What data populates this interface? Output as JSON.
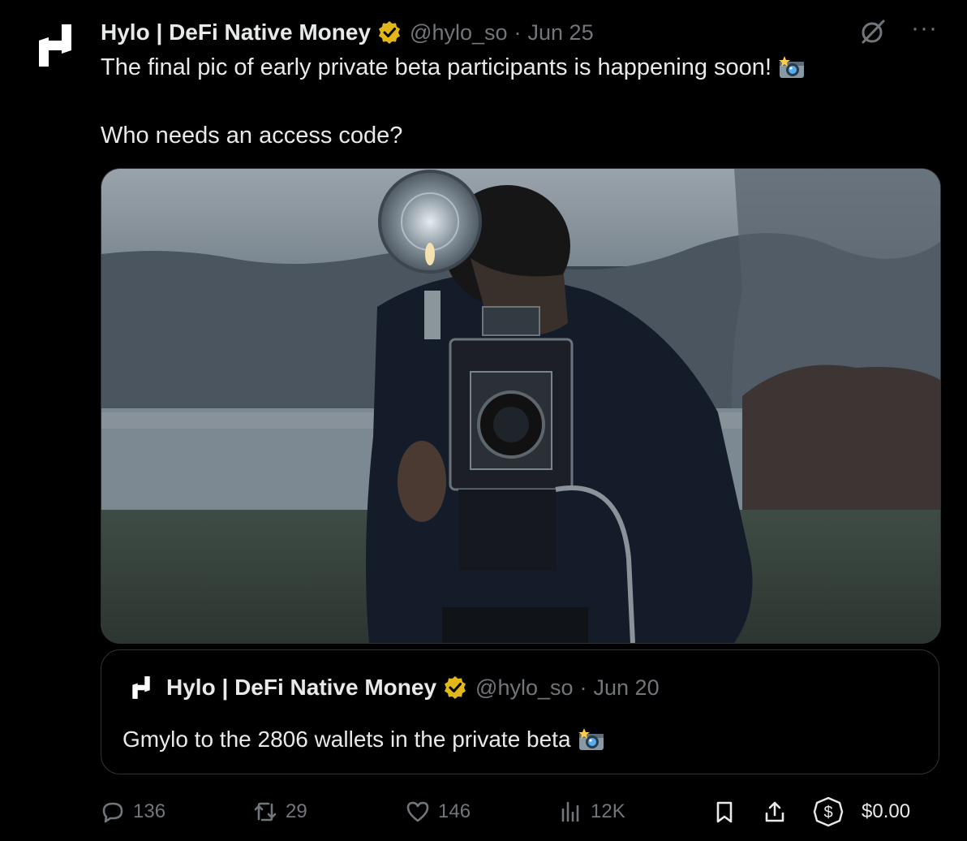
{
  "tweet": {
    "author_name": "Hylo | DeFi Native Money",
    "handle": "@hylo_so",
    "separator": "·",
    "date": "Jun 25",
    "text_line1": "The final pic of early private beta participants is happening soon!",
    "text_line2": "Who needs an access code?",
    "media_description": "Man looking through vintage press camera with flash outdoors",
    "icons": {
      "avatar": "hylo-logo-icon",
      "verified": "verified-badge-icon",
      "grok": "grok-icon",
      "more": "more-icon",
      "emoji": "camera-flash-emoji"
    },
    "more_glyph": "···"
  },
  "quote": {
    "author_name": "Hylo | DeFi Native Money",
    "handle": "@hylo_so",
    "separator": "·",
    "date": "Jun 20",
    "text": "Gmylo to the 2806 wallets in the private beta"
  },
  "actions": {
    "replies": "136",
    "reposts": "29",
    "likes": "146",
    "views": "12K",
    "tip": "$0.00"
  },
  "colors": {
    "background": "#000000",
    "text": "#e7e9ea",
    "muted": "#71767b",
    "border": "#2f3336",
    "verified_gold": "#e2b719"
  }
}
